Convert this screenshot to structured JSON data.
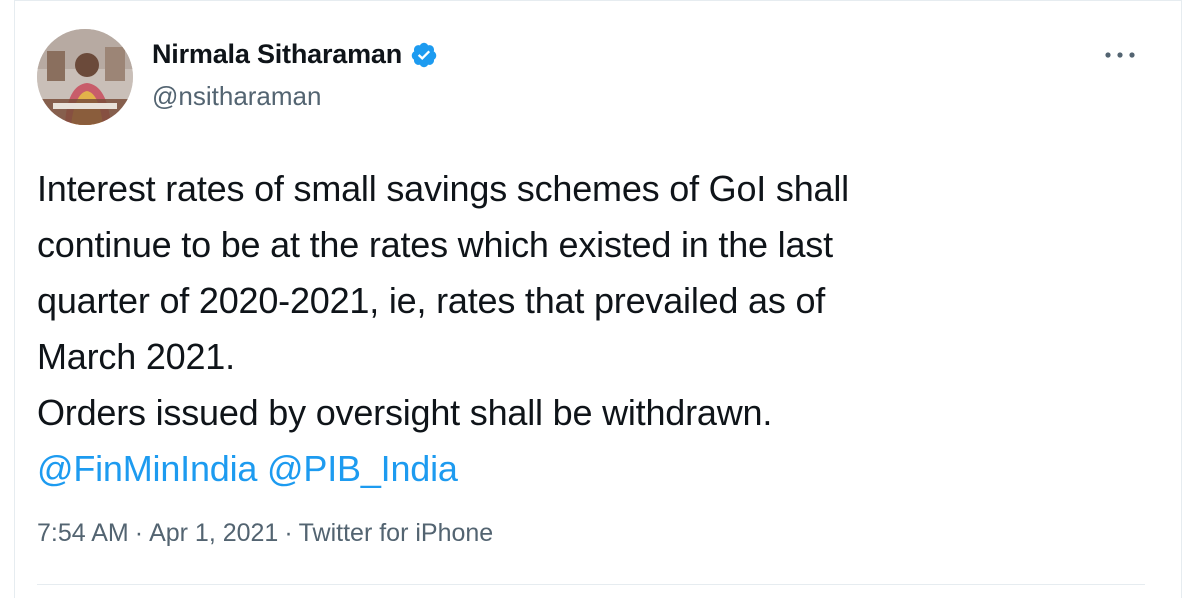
{
  "author": {
    "name": "Nirmala Sitharaman",
    "handle": "@nsitharaman",
    "verified": true
  },
  "tweet": {
    "lines": [
      "Interest rates of small savings schemes of GoI shall",
      "continue to be at the rates which existed in the last",
      "quarter of 2020-2021, ie, rates that prevailed as of",
      "March 2021.",
      "Orders issued by oversight shall be withdrawn."
    ],
    "mentions": [
      "@FinMinIndia",
      "@PIB_India"
    ]
  },
  "meta": {
    "time": "7:54 AM",
    "date": "Apr 1, 2021",
    "source": "Twitter for iPhone",
    "separator": "·"
  },
  "icons": {
    "verified": "verified-badge-icon",
    "more": "more-options-icon"
  },
  "colors": {
    "accent": "#1d9bf0",
    "text": "#0f1419",
    "secondary": "#536471",
    "border": "#e6ecf0"
  }
}
